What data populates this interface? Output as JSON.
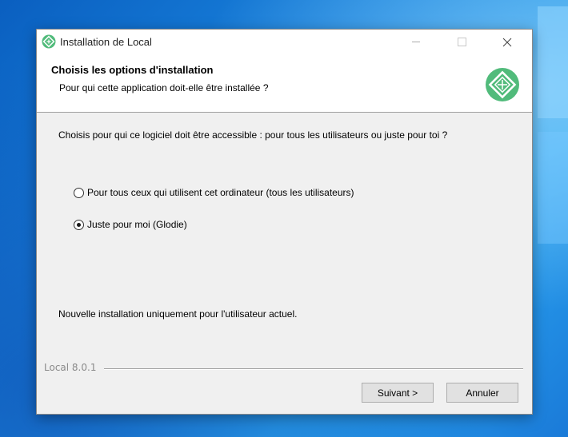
{
  "window": {
    "title": "Installation de Local"
  },
  "header": {
    "title": "Choisis les options d'installation",
    "subtitle": "Pour qui cette application doit-elle être installée ?"
  },
  "main": {
    "intro": "Choisis pour qui ce logiciel doit être accessible : pour tous les utilisateurs ou juste pour toi ?",
    "options": [
      {
        "label": "Pour tous ceux qui utilisent cet ordinateur (tous les utilisateurs)",
        "checked": false
      },
      {
        "label": "Juste pour moi (Glodie)",
        "checked": true
      }
    ],
    "note": "Nouvelle installation uniquement pour l'utilisateur actuel."
  },
  "footer": {
    "version": "Local 8.0.1",
    "next_label": "Suivant >",
    "cancel_label": "Annuler"
  },
  "colors": {
    "brand": "#51bb7b",
    "desktop": "#1a86e0"
  },
  "icons": {
    "app": "local-app-icon",
    "logo": "local-logo-icon",
    "minimize": "minimize-icon",
    "maximize": "maximize-icon",
    "close": "close-icon"
  }
}
